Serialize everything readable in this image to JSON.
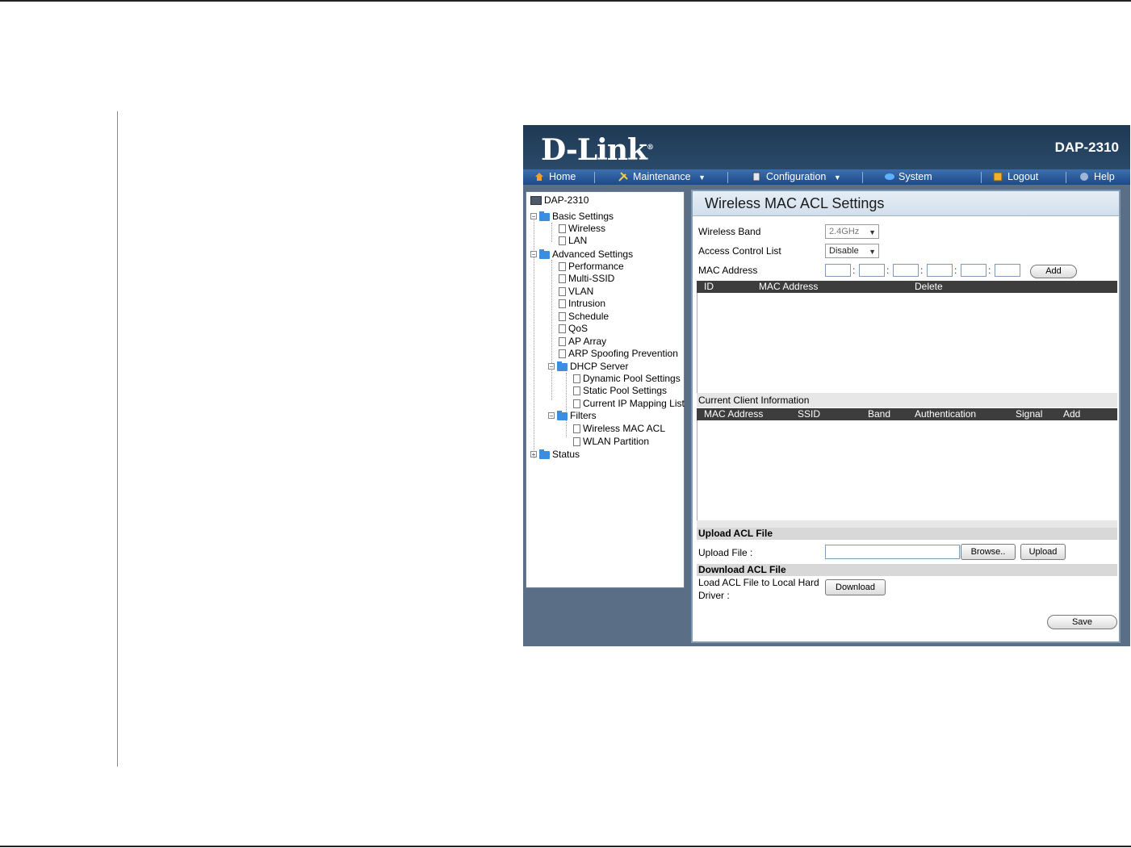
{
  "brand": {
    "logo": "D-Link",
    "model": "DAP-2310"
  },
  "menu": [
    {
      "label": "Home",
      "icon": "home-icon"
    },
    {
      "label": "Maintenance",
      "icon": "tools-icon",
      "dropdown": true
    },
    {
      "label": "Configuration",
      "icon": "config-icon",
      "dropdown": true
    },
    {
      "label": "System",
      "icon": "system-icon"
    },
    {
      "label": "Logout",
      "icon": "logout-icon"
    },
    {
      "label": "Help",
      "icon": "help-icon"
    }
  ],
  "tree": {
    "root": "DAP-2310",
    "basic": "Basic Settings",
    "wireless": "Wireless",
    "lan": "LAN",
    "advanced": "Advanced Settings",
    "performance": "Performance",
    "multi_ssid": "Multi-SSID",
    "vlan": "VLAN",
    "intrusion": "Intrusion",
    "schedule": "Schedule",
    "qos": "QoS",
    "ap_array": "AP Array",
    "arp": "ARP Spoofing Prevention",
    "dhcp": "DHCP Server",
    "dynamic_pool": "Dynamic Pool Settings",
    "static_pool": "Static Pool Settings",
    "current_ip": "Current IP Mapping List",
    "filters": "Filters",
    "wireless_mac_acl": "Wireless MAC ACL",
    "wlan_partition": "WLAN Partition",
    "status": "Status"
  },
  "page": {
    "title": "Wireless MAC ACL Settings",
    "wireless_band_label": "Wireless Band",
    "wireless_band_value": "2.4GHz",
    "acl_label": "Access Control List",
    "acl_value": "Disable",
    "mac_label": "MAC Address",
    "add_button": "Add",
    "acl_table_headers": {
      "id": "ID",
      "mac": "MAC Address",
      "delete": "Delete"
    },
    "client_info_label": "Current Client Information",
    "client_table_headers": {
      "mac": "MAC Address",
      "ssid": "SSID",
      "band": "Band",
      "auth": "Authentication",
      "signal": "Signal",
      "add": "Add"
    },
    "upload_section": "Upload ACL File",
    "upload_label": "Upload File :",
    "browse_button": "Browse..",
    "upload_button": "Upload",
    "download_section": "Download ACL File",
    "download_label_1": "Load ACL File to Local Hard",
    "download_label_2": "Driver :",
    "download_button": "Download",
    "save_button": "Save"
  },
  "colors": {
    "header_bg": "#1f3954",
    "menubar_bg": "#2a5b9c",
    "app_bg": "#5a6e86",
    "table_header_bg": "#3d3d3d"
  }
}
